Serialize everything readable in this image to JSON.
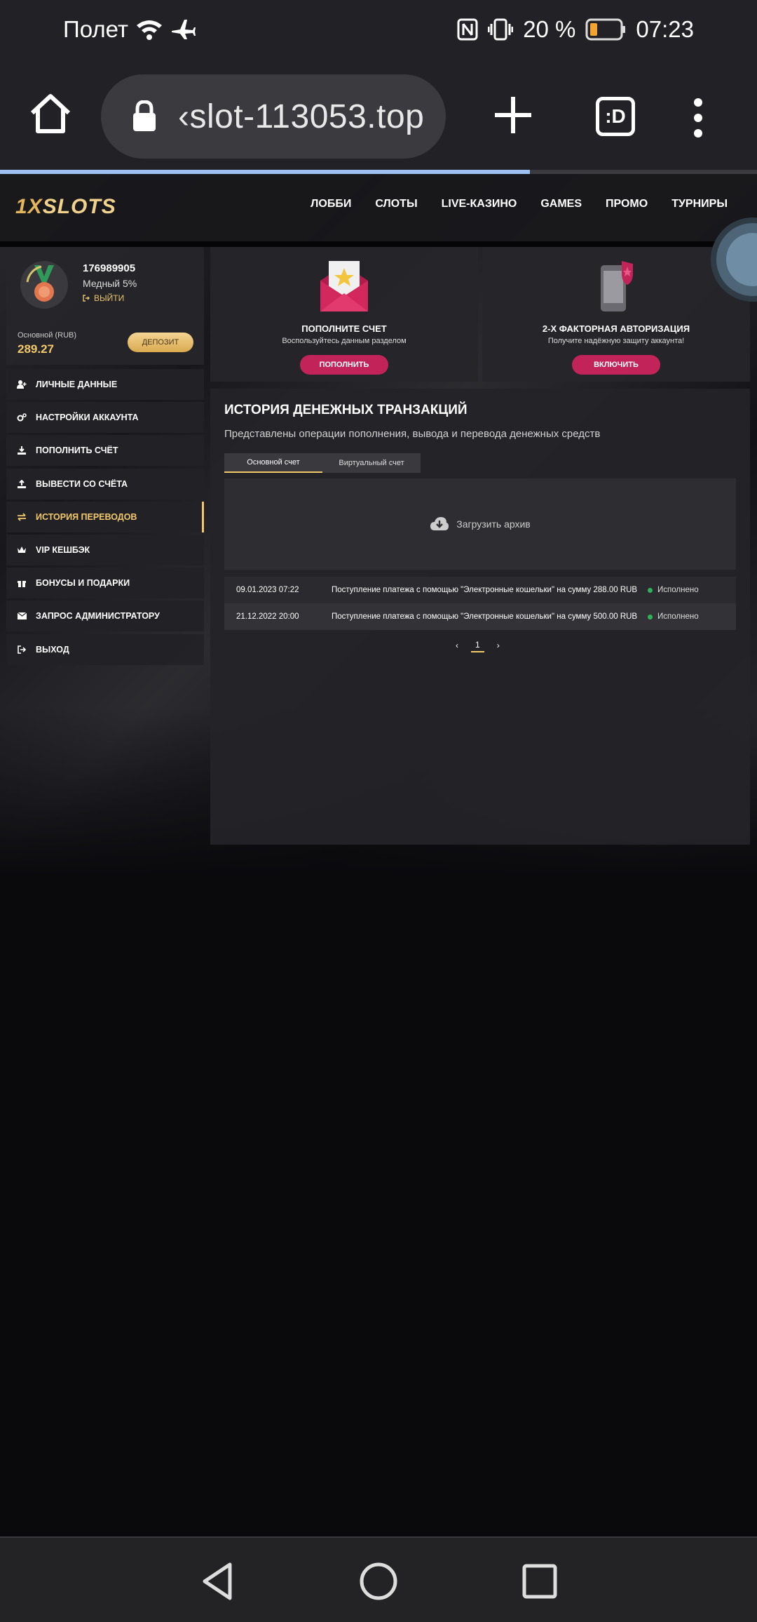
{
  "status_bar": {
    "carrier": "Полет",
    "battery": "20 %",
    "time": "07:23",
    "icons": [
      "wifi-icon",
      "airplane-icon",
      "nfc-icon",
      "vibrate-icon",
      "battery-icon"
    ]
  },
  "browser": {
    "url": "‹slot-113053.top",
    "tabs_label": ":D",
    "progress": 0.7
  },
  "site": {
    "logo_one": "1X",
    "logo_rest": "SLOTS",
    "nav": [
      "ЛОББИ",
      "СЛОТЫ",
      "LIVE-КАЗИНО",
      "GAMES",
      "ПРОМО",
      "ТУРНИРЫ"
    ]
  },
  "profile": {
    "user_id": "176989905",
    "level": "Медный 5%",
    "logout": "ВЫЙТИ",
    "account_label": "Основной (RUB)",
    "balance": "289.27",
    "deposit": "ДЕПОЗИТ"
  },
  "menu": [
    {
      "label": "ЛИЧНЫЕ ДАННЫЕ",
      "icon": "user-plus-icon"
    },
    {
      "label": "НАСТРОЙКИ АККАУНТА",
      "icon": "gears-icon"
    },
    {
      "label": "ПОПОЛНИТЬ СЧЁТ",
      "icon": "download-icon"
    },
    {
      "label": "ВЫВЕСТИ СО СЧЁТА",
      "icon": "upload-icon"
    },
    {
      "label": "ИСТОРИЯ ПЕРЕВОДОВ",
      "icon": "transfer-icon",
      "active": true
    },
    {
      "label": "VIP КЕШБЭК",
      "icon": "crown-icon"
    },
    {
      "label": "БОНУСЫ И ПОДАРКИ",
      "icon": "gift-icon"
    },
    {
      "label": "ЗАПРОС АДМИНИСТРАТОРУ",
      "icon": "envelope-icon"
    },
    {
      "label": "ВЫХОД",
      "icon": "exit-icon"
    }
  ],
  "cards": [
    {
      "title": "ПОПОЛНИТЕ СЧЕТ",
      "subtitle": "Воспользуйтесь данным разделом",
      "button": "ПОПОЛНИТЬ",
      "icon": "envelope-star-icon"
    },
    {
      "title": "2-Х ФАКТОРНАЯ АВТОРИЗАЦИЯ",
      "subtitle": "Получите надёжную защиту аккаунта!",
      "button": "ВКЛЮЧИТЬ",
      "icon": "phone-shield-icon"
    }
  ],
  "transactions": {
    "title": "ИСТОРИЯ ДЕНЕЖНЫХ ТРАНЗАКЦИЙ",
    "description": "Представлены операции пополнения, вывода и перевода денежных средств",
    "tabs": [
      "Основной счет",
      "Виртуальный счет"
    ],
    "archive_label": "Загрузить архив",
    "rows": [
      {
        "date": "09.01.2023 07:22",
        "text": "Поступление платежа с помощью \"Электронные кошельки\" на сумму 288.00 RUB",
        "status": "Исполнено"
      },
      {
        "date": "21.12.2022 20:00",
        "text": "Поступление платежа с помощью \"Электронные кошельки\" на сумму 500.00 RUB",
        "status": "Исполнено"
      }
    ],
    "page": "1"
  },
  "colors": {
    "accent_gold": "#f1c96b",
    "button_pink": "#c2245a",
    "status_green": "#2fb35a"
  }
}
